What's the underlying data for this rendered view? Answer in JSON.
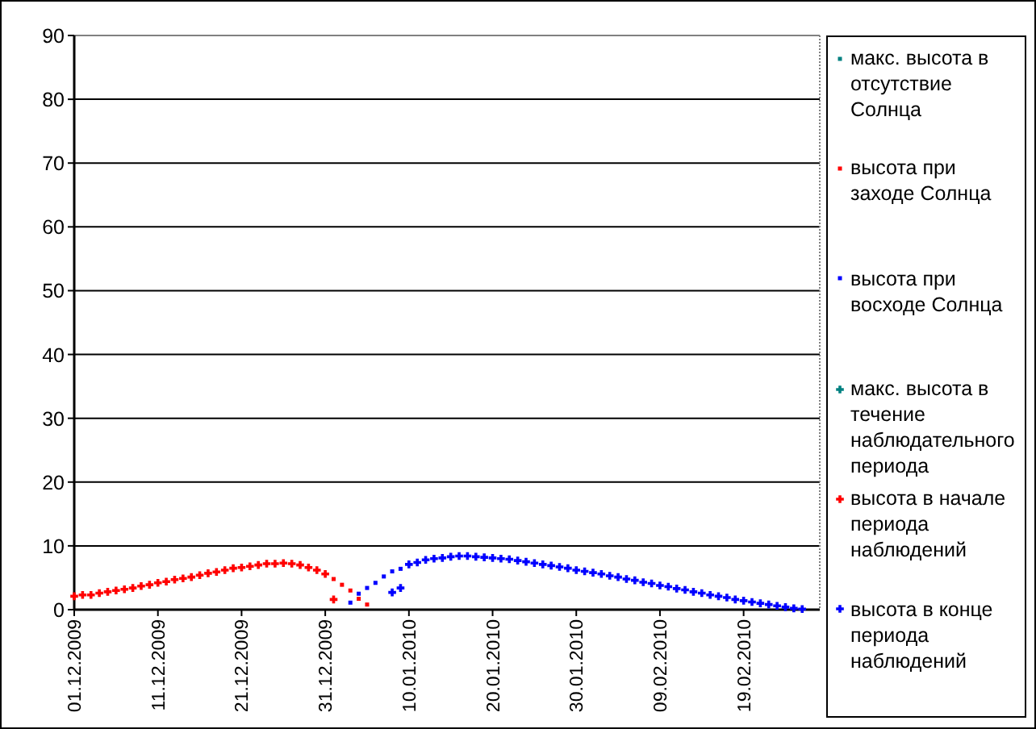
{
  "chart_data": {
    "type": "scatter",
    "categories": [
      "01.12.2009",
      null,
      null,
      null,
      null,
      null,
      null,
      null,
      null,
      null,
      "11.12.2009",
      null,
      null,
      null,
      null,
      null,
      null,
      null,
      null,
      null,
      "21.12.2009",
      null,
      null,
      null,
      null,
      null,
      null,
      null,
      null,
      null,
      "31.12.2009",
      null,
      null,
      null,
      null,
      null,
      null,
      null,
      null,
      null,
      "10.01.2010",
      null,
      null,
      null,
      null,
      null,
      null,
      null,
      null,
      null,
      "20.01.2010",
      null,
      null,
      null,
      null,
      null,
      null,
      null,
      null,
      null,
      "30.01.2010",
      null,
      null,
      null,
      null,
      null,
      null,
      null,
      null,
      null,
      "09.02.2010",
      null,
      null,
      null,
      null,
      null,
      null,
      null,
      null,
      null,
      "19.02.2010",
      null,
      null,
      null,
      null,
      null,
      null,
      null,
      null
    ],
    "ylim": [
      0,
      90
    ],
    "grid": true,
    "yticks": [
      0,
      10,
      20,
      30,
      40,
      50,
      60,
      70,
      80,
      90
    ],
    "series": [
      {
        "name": "макс. высота в отсутствие Солнца",
        "color": "#008080",
        "marker": "square",
        "values": [
          null,
          null,
          null,
          null,
          null,
          null,
          null,
          null,
          null,
          null,
          null,
          null,
          null,
          null,
          null,
          null,
          null,
          null,
          null,
          null,
          null,
          null,
          null,
          null,
          null,
          null,
          null,
          null,
          null,
          null,
          null,
          null,
          null,
          null,
          null,
          null,
          null,
          null,
          null,
          null,
          null,
          null,
          null,
          null,
          null,
          null,
          null,
          null,
          null,
          null,
          null,
          null,
          null,
          null,
          null,
          null,
          null,
          null,
          null,
          null,
          null,
          null,
          null,
          null,
          null,
          null,
          null,
          null,
          null,
          null,
          null,
          null,
          null,
          null,
          null,
          null,
          null,
          null,
          null,
          null,
          null,
          null,
          null,
          null,
          null,
          null,
          null,
          null,
          null
        ]
      },
      {
        "name": "высота при заходе Солнца",
        "color": "#ff0000",
        "marker": "square",
        "values": [
          null,
          null,
          null,
          null,
          null,
          null,
          null,
          null,
          null,
          null,
          null,
          null,
          null,
          null,
          null,
          null,
          null,
          null,
          null,
          null,
          null,
          null,
          null,
          null,
          null,
          null,
          null,
          null,
          null,
          null,
          null,
          4.8,
          3.9,
          3.0,
          1.7,
          0.8,
          null,
          null,
          null,
          null,
          null,
          null,
          null,
          null,
          null,
          null,
          null,
          null,
          null,
          null,
          null,
          null,
          null,
          null,
          null,
          null,
          null,
          null,
          null,
          null,
          null,
          null,
          null,
          null,
          null,
          null,
          null,
          null,
          null,
          null,
          null,
          null,
          null,
          null,
          null,
          null,
          null,
          null,
          null,
          null,
          null,
          null,
          null,
          null,
          null,
          null,
          null,
          null,
          null
        ]
      },
      {
        "name": "высота при восходе Солнца",
        "color": "#0000ff",
        "marker": "square",
        "values": [
          null,
          null,
          null,
          null,
          null,
          null,
          null,
          null,
          null,
          null,
          null,
          null,
          null,
          null,
          null,
          null,
          null,
          null,
          null,
          null,
          null,
          null,
          null,
          null,
          null,
          null,
          null,
          null,
          null,
          null,
          null,
          null,
          null,
          1.1,
          2.5,
          3.4,
          4.2,
          5.2,
          6.0,
          6.4,
          null,
          null,
          null,
          null,
          null,
          null,
          null,
          null,
          null,
          null,
          null,
          null,
          null,
          null,
          null,
          null,
          null,
          null,
          null,
          null,
          null,
          null,
          null,
          null,
          null,
          null,
          null,
          null,
          null,
          null,
          null,
          null,
          null,
          null,
          null,
          null,
          null,
          null,
          null,
          null,
          null,
          null,
          null,
          null,
          null,
          null,
          null,
          null,
          null
        ]
      },
      {
        "name": "макс. высота в течение наблюдательного периода",
        "color": "#008080",
        "marker": "cross",
        "values": [
          null,
          null,
          null,
          null,
          null,
          null,
          null,
          null,
          null,
          null,
          null,
          null,
          null,
          null,
          null,
          null,
          null,
          null,
          null,
          null,
          null,
          null,
          null,
          null,
          null,
          null,
          null,
          null,
          null,
          null,
          null,
          null,
          null,
          null,
          null,
          null,
          null,
          null,
          null,
          null,
          null,
          null,
          null,
          null,
          null,
          null,
          null,
          null,
          null,
          null,
          null,
          null,
          null,
          null,
          null,
          null,
          null,
          null,
          null,
          null,
          null,
          null,
          null,
          null,
          null,
          null,
          null,
          null,
          null,
          null,
          null,
          null,
          null,
          null,
          null,
          null,
          null,
          null,
          null,
          null,
          null,
          null,
          null,
          null,
          null,
          null,
          null,
          null,
          null
        ]
      },
      {
        "name": "высота в начале периода наблюдений",
        "color": "#ff0000",
        "marker": "cross",
        "values": [
          2.1,
          2.3,
          2.3,
          2.6,
          2.8,
          3.0,
          3.2,
          3.4,
          3.7,
          3.9,
          4.2,
          4.4,
          4.7,
          4.9,
          5.1,
          5.4,
          5.7,
          5.9,
          6.2,
          6.5,
          6.6,
          6.8,
          7.0,
          7.2,
          7.2,
          7.3,
          7.2,
          7.0,
          6.6,
          6.2,
          5.6,
          1.6,
          null,
          null,
          null,
          null,
          null,
          null,
          null,
          null,
          null,
          null,
          null,
          null,
          null,
          null,
          null,
          null,
          null,
          null,
          null,
          null,
          null,
          null,
          null,
          null,
          null,
          null,
          null,
          null,
          null,
          null,
          null,
          null,
          null,
          null,
          null,
          null,
          null,
          null,
          null,
          null,
          null,
          null,
          null,
          null,
          null,
          null,
          null,
          null,
          null,
          null,
          null,
          null,
          null,
          null,
          null,
          null,
          null
        ]
      },
      {
        "name": "высота в конце периода наблюдений",
        "color": "#0000ff",
        "marker": "cross",
        "values": [
          null,
          null,
          null,
          null,
          null,
          null,
          null,
          null,
          null,
          null,
          null,
          null,
          null,
          null,
          null,
          null,
          null,
          null,
          null,
          null,
          null,
          null,
          null,
          null,
          null,
          null,
          null,
          null,
          null,
          null,
          null,
          null,
          null,
          null,
          null,
          null,
          null,
          null,
          2.7,
          3.4,
          7.1,
          7.4,
          7.8,
          8.0,
          8.1,
          8.3,
          8.4,
          8.4,
          8.3,
          8.2,
          8.1,
          8.0,
          7.9,
          7.7,
          7.5,
          7.3,
          7.1,
          6.9,
          6.7,
          6.5,
          6.2,
          6.0,
          5.8,
          5.6,
          5.3,
          5.1,
          4.8,
          4.6,
          4.3,
          4.1,
          3.8,
          3.6,
          3.3,
          3.1,
          2.8,
          2.6,
          2.3,
          2.1,
          1.9,
          1.6,
          1.4,
          1.2,
          1.0,
          0.8,
          0.6,
          0.4,
          0.2,
          0.1,
          null
        ]
      }
    ]
  }
}
